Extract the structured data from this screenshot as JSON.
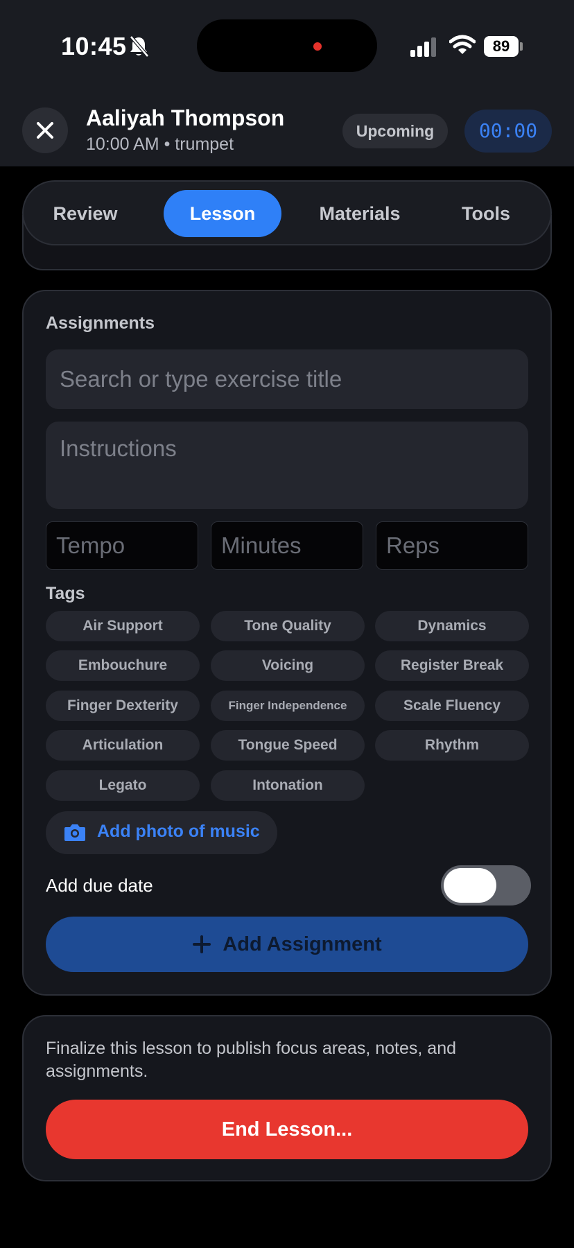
{
  "status_bar": {
    "time": "10:45",
    "battery": "89",
    "icons": [
      "bell-slash-icon",
      "signal-icon",
      "wifi-icon",
      "battery-icon"
    ]
  },
  "header": {
    "student_name": "Aaliyah Thompson",
    "lesson_meta": "10:00 AM • trumpet",
    "status": "Upcoming",
    "timer": "00:00",
    "close_icon": "close-icon"
  },
  "tabs": {
    "items": [
      {
        "label": "Review"
      },
      {
        "label": "Lesson"
      },
      {
        "label": "Materials"
      },
      {
        "label": "Tools"
      }
    ],
    "active": "Lesson"
  },
  "assignments": {
    "title": "Assignments",
    "search_placeholder": "Search or type exercise title",
    "instructions_placeholder": "Instructions",
    "tempo_placeholder": "Tempo",
    "minutes_placeholder": "Minutes",
    "reps_placeholder": "Reps",
    "tags_label": "Tags",
    "tags": [
      "Air Support",
      "Tone Quality",
      "Dynamics",
      "Embouchure",
      "Voicing",
      "Register Break",
      "Finger Dexterity",
      "Finger Independence",
      "Scale Fluency",
      "Articulation",
      "Tongue Speed",
      "Rhythm",
      "Legato",
      "Intonation"
    ],
    "add_photo_label": "Add photo of music",
    "due_date_label": "Add due date",
    "due_date_enabled": false,
    "add_button_label": "Add Assignment"
  },
  "finalize": {
    "text": "Finalize this lesson to publish focus areas, notes, and assignments.",
    "end_button_label": "End Lesson..."
  },
  "colors": {
    "accent_blue": "#2f80f7",
    "danger_red": "#e8372f",
    "card_bg": "#15171d",
    "header_bg": "#1a1c22"
  }
}
